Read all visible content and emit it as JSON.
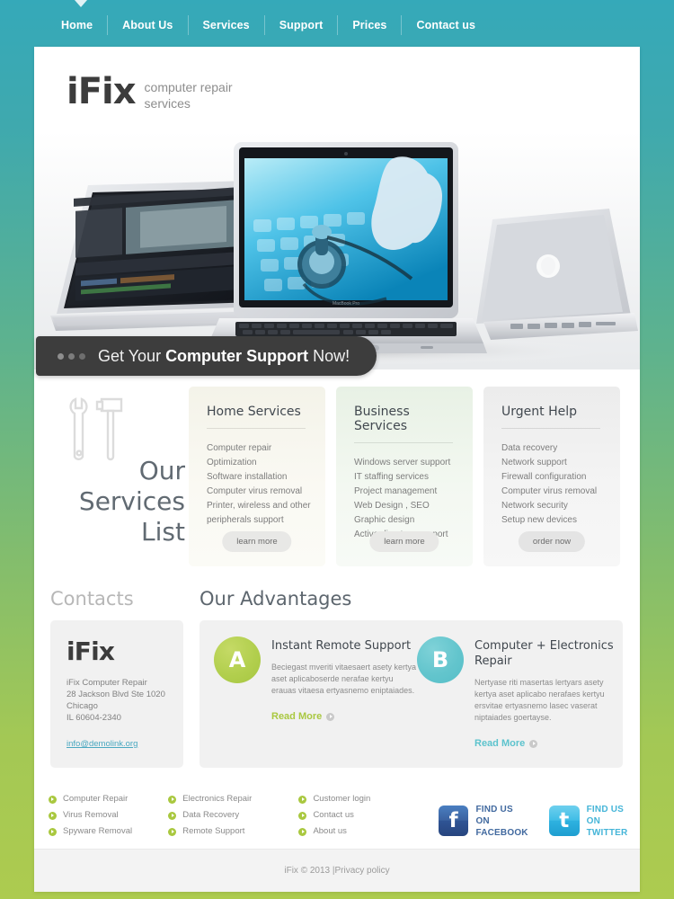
{
  "site": {
    "logo_mark": "iFix",
    "logo_tagline": "computer repair services"
  },
  "nav": {
    "items": [
      {
        "label": "Home"
      },
      {
        "label": "About Us"
      },
      {
        "label": "Services"
      },
      {
        "label": "Support"
      },
      {
        "label": "Prices"
      },
      {
        "label": "Contact us"
      }
    ]
  },
  "hero": {
    "banner_prefix": "Get Your ",
    "banner_strong": "Computer Support",
    "banner_suffix": " Now!"
  },
  "services": {
    "heading": "Our Services List",
    "icon": "tools-icon",
    "cards": [
      {
        "title": "Home Services",
        "items": [
          "Computer repair",
          "Optimization",
          "Software installation",
          "Computer virus removal",
          "Printer, wireless and other",
          "peripherals support"
        ],
        "button": "learn more"
      },
      {
        "title": "Business Services",
        "items": [
          "Windows server support",
          "IT staffing services",
          "Project management",
          "Web Design , SEO",
          "Graphic design",
          "Active directory support"
        ],
        "button": "learn more"
      },
      {
        "title": "Urgent Help",
        "items": [
          "Data recovery",
          "Network support",
          "Firewall configuration",
          "Computer virus removal",
          "Network security",
          "Setup new devices"
        ],
        "button": "order now"
      }
    ]
  },
  "contacts": {
    "heading": "Contacts",
    "logo": "iFix",
    "address_lines": [
      "iFix Computer Repair",
      "28 Jackson Blvd Ste 1020",
      "Chicago",
      "IL 60604-2340"
    ],
    "email": "info@demolink.org"
  },
  "advantages": {
    "heading": "Our Advantages",
    "items": [
      {
        "badge": "A",
        "badge_color": "#aecb48",
        "title": "Instant Remote Support",
        "text": "Beciegast mveriti vitaesaert asety kertya aset aplicaboserde nerafae kertyu erauas vitaesa ertyasnemo eniptaiades.",
        "link": "Read More"
      },
      {
        "badge": "B",
        "badge_color": "#5cc3cd",
        "title": "Computer + Electronics Repair",
        "text": "Nertyase riti masertas lertyars asety kertya aset aplicabo nerafaes kertyu ersvitae ertyasnemo lasec vaserat niptaiades goertayse.",
        "link": "Read More"
      }
    ]
  },
  "footer": {
    "columns": [
      {
        "links": [
          "Computer Repair",
          "Virus Removal",
          "Spyware Removal"
        ]
      },
      {
        "links": [
          "Electronics Repair",
          "Data Recovery",
          "Remote Support"
        ]
      },
      {
        "links": [
          "Customer login",
          "Contact us",
          "About us"
        ]
      }
    ],
    "social": [
      {
        "icon": "facebook-icon",
        "line1": "FIND US ON",
        "line2": "FACEBOOK",
        "glyph": "f"
      },
      {
        "icon": "twitter-icon",
        "line1": "FIND US ON",
        "line2": "TWITTER",
        "glyph": "t"
      }
    ],
    "copyright": "iFix © 2013  |  ",
    "privacy": "Privacy policy"
  },
  "colors": {
    "brand_teal": "#35a9b9",
    "brand_green": "#a9c83f",
    "dark_banner": "#3d3d3d",
    "link_blue": "#4aa8c0"
  }
}
